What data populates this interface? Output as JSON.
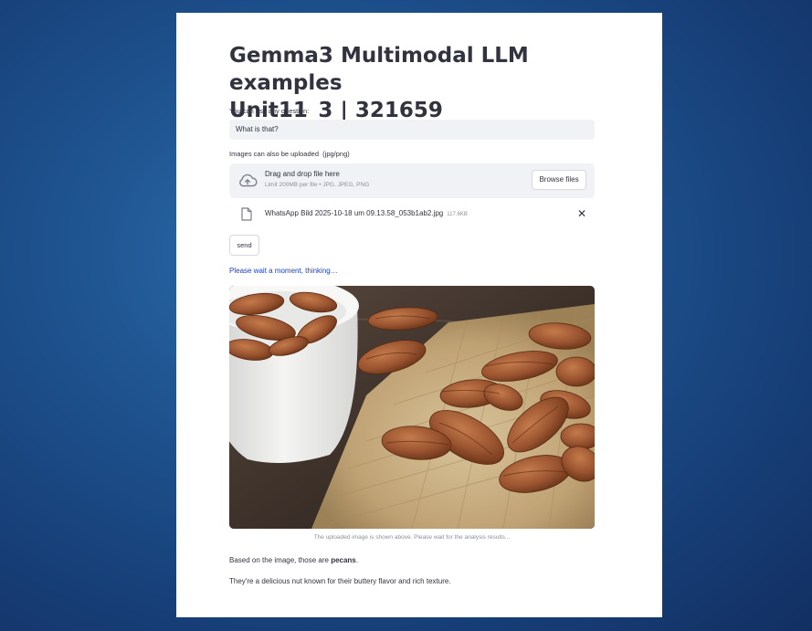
{
  "header": {
    "title_line1": "Gemma3 Multimodal LLM examples",
    "title_line2": "Unit11_3 | 321659"
  },
  "question": {
    "label": "You can ask any question:",
    "value": "What is that?"
  },
  "upload": {
    "label": "Images can also be uploaded  (jpg/png)",
    "dropzone_title": "Drag and drop file here",
    "dropzone_limit": "Limit 200MB per file • JPG, JPEG, PNG",
    "browse_label": "Browse files",
    "file_name": "WhatsApp Bild 2025-10-18 um 09.13.58_053b1ab2.jpg",
    "file_size": "117.6KB",
    "close_glyph": "✕"
  },
  "send_label": "send",
  "status_text": "Please wait a moment, thinking…",
  "image": {
    "caption": "The uploaded image is shown above. Please wait for the analysis results..."
  },
  "answer": {
    "line1_prefix": "Based on the image, those are ",
    "line1_bold": "pecans",
    "line1_suffix": ".",
    "line2": "They're a delicious nut known for their buttery flavor and rich texture."
  },
  "icons": {
    "upload": "cloud-upload-icon",
    "file": "file-icon",
    "close": "close-icon"
  },
  "colors": {
    "background": "#1f5591",
    "status_text": "#1c3fcf",
    "input_bg": "#f0f2f6",
    "text": "#31333f"
  }
}
